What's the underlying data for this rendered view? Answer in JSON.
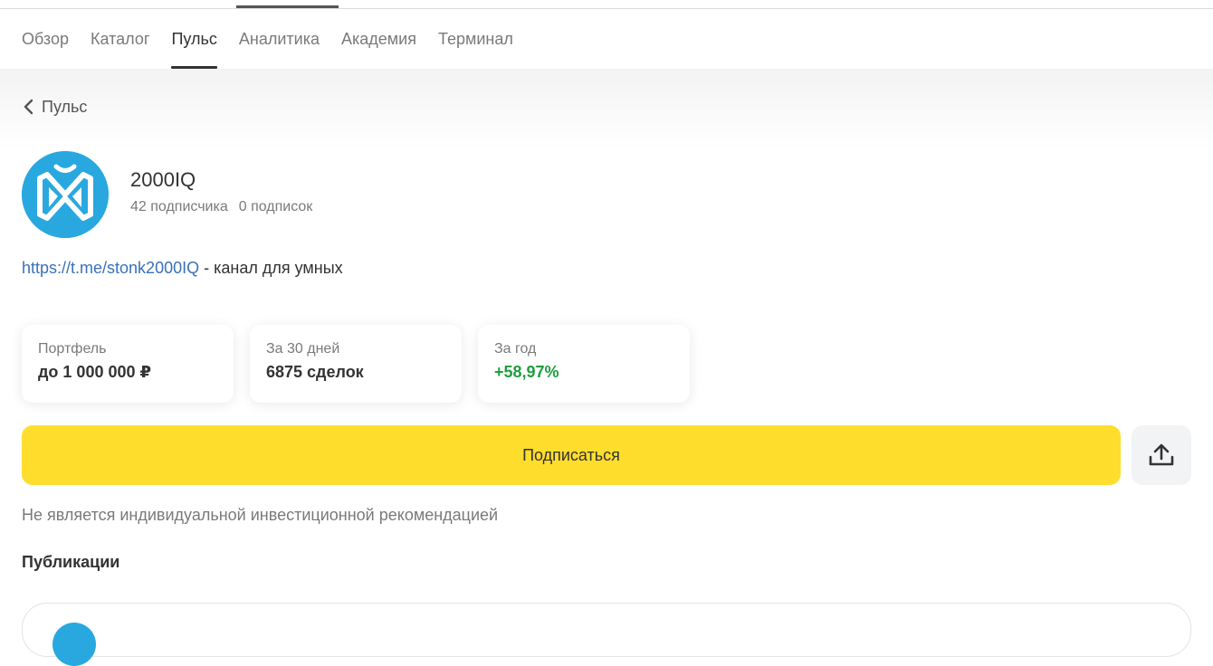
{
  "nav": {
    "items": [
      {
        "label": "Обзор",
        "active": false
      },
      {
        "label": "Каталог",
        "active": false
      },
      {
        "label": "Пульс",
        "active": true
      },
      {
        "label": "Аналитика",
        "active": false
      },
      {
        "label": "Академия",
        "active": false
      },
      {
        "label": "Терминал",
        "active": false
      }
    ]
  },
  "back": {
    "label": "Пульс",
    "icon": "chevron-left-icon"
  },
  "profile": {
    "name": "2000IQ",
    "followers": "42 подписчика",
    "following": "0 подписок",
    "avatar_icon": "channel-logo-icon",
    "avatar_color": "#29a8e0"
  },
  "description": {
    "link": "https://t.me/stonk2000IQ",
    "text": " - канал для умных"
  },
  "stats": [
    {
      "label": "Портфель",
      "value": "до 1 000 000 ₽",
      "positive": false
    },
    {
      "label": "За 30 дней",
      "value": "6875 сделок",
      "positive": false
    },
    {
      "label": "За год",
      "value": "+58,97%",
      "positive": true
    }
  ],
  "actions": {
    "subscribe_label": "Подписаться",
    "share_icon": "share-upload-icon",
    "accent": "#ffdd2d"
  },
  "disclaimer": "Не является индивидуальной инвестиционной рекомендацией",
  "publications_title": "Публикации"
}
